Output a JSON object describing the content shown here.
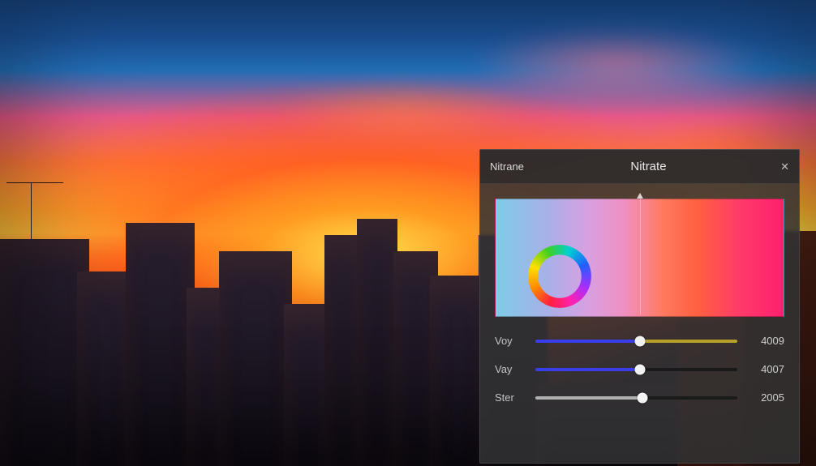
{
  "panel": {
    "tab_label": "Nitrane",
    "title": "Nitrate",
    "close_glyph": "✕"
  },
  "color_picker": {
    "pointer_pct": 50
  },
  "sliders": [
    {
      "label": "Voy",
      "value": "4009",
      "thumb_pct": 52,
      "track_class": "t1"
    },
    {
      "label": "Vay",
      "value": "4007",
      "thumb_pct": 52,
      "track_class": "t2"
    },
    {
      "label": "Ster",
      "value": "2005",
      "thumb_pct": 53,
      "track_class": "t3"
    }
  ]
}
